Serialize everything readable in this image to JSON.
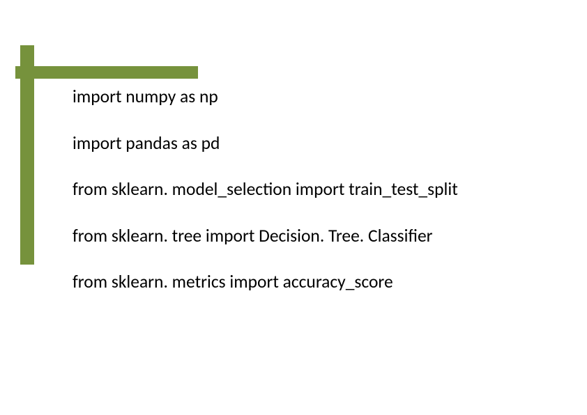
{
  "lines": [
    "import numpy as np",
    "import pandas as pd",
    "from sklearn. model_selection import train_test_split",
    "from sklearn. tree import Decision. Tree. Classifier",
    "from sklearn. metrics import accuracy_score"
  ]
}
